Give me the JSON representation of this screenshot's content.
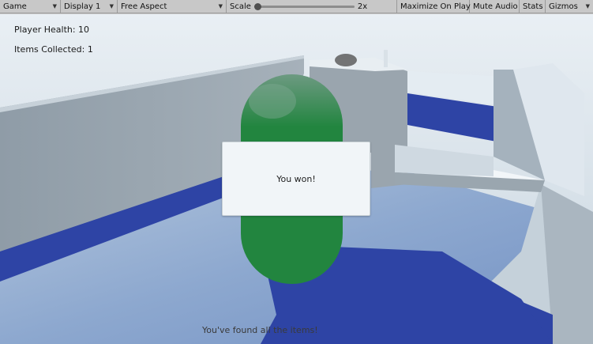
{
  "toolbar": {
    "view_select": "Game",
    "display_select": "Display 1",
    "aspect_select": "Free Aspect",
    "scale_label": "Scale",
    "scale_value": "2x",
    "maximize_on_play": "Maximize On Play",
    "mute_audio": "Mute Audio",
    "stats": "Stats",
    "gizmos": "Gizmos"
  },
  "hud": {
    "player_health": "Player Health: 10",
    "items_collected": "Items Collected: 1"
  },
  "dialog": {
    "message": "You won!"
  },
  "footer_message": "You've found all the items!",
  "colors": {
    "toolbar_bg": "#c8c8c8",
    "sky": "#dce7ef",
    "wall": "#96a3ae",
    "floor_blue": "#2e44a5",
    "player_green": "#22853f"
  }
}
